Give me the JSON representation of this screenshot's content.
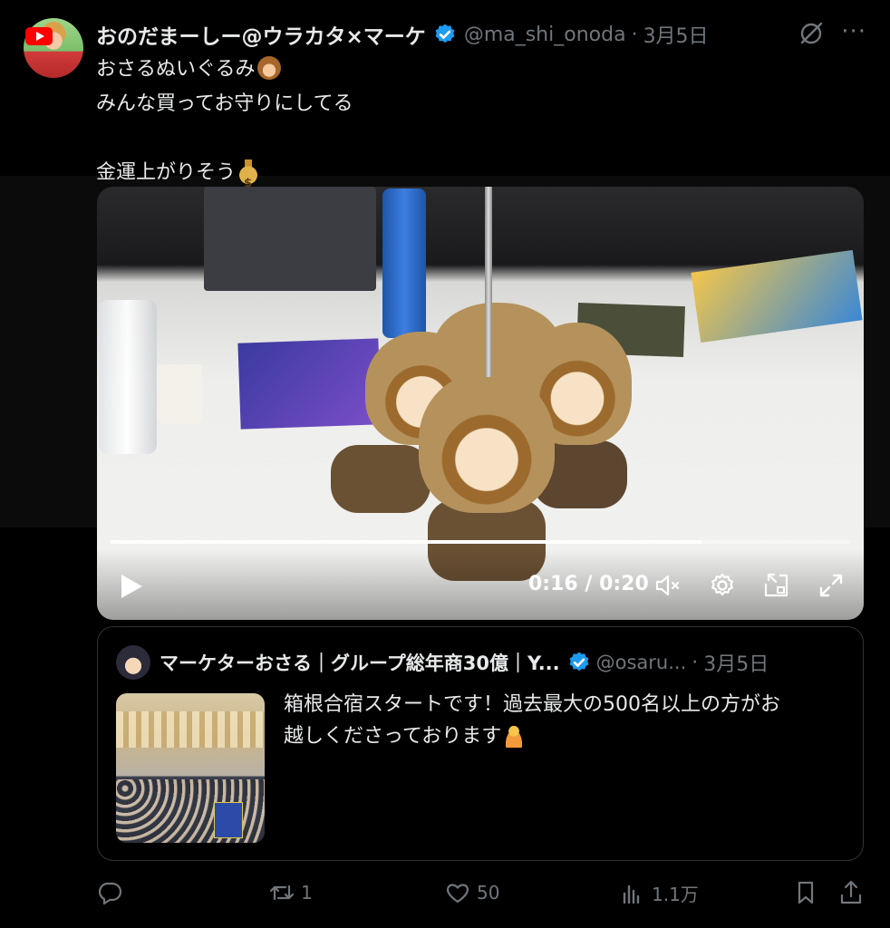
{
  "tweet": {
    "author_name": "おのだまーしー@ウラカタ×マーケ",
    "author_handle": "@ma_shi_onoda",
    "separator": "·",
    "date": "3月5日",
    "more_label": "···",
    "lines": [
      "おさるぬいぐるみ",
      "みんな買ってお守りにしてる",
      "",
      "金運上がりそう"
    ]
  },
  "video": {
    "timecode": "0:16 / 0:20",
    "progress": 0.8
  },
  "quote": {
    "author_name": "マーケターおさる｜グループ総年商30億｜Y...",
    "author_handle": "@osaru...",
    "separator": "·",
    "date": "3月5日",
    "text_line1": "箱根合宿スタートです！過去最大の500名以上の方がお",
    "text_line2": "越しくださっております"
  },
  "actions": {
    "reply_count": "",
    "retweet_count": "1",
    "like_count": "50",
    "views_count": "1.1万"
  },
  "colors": {
    "background": "#000000",
    "text": "#e7e9ea",
    "muted": "#71767b",
    "verified": "#1d9bf0",
    "border": "#2f3336"
  },
  "icons": [
    "youtube-badge-icon",
    "verified-badge-icon",
    "grok-icon",
    "more-icon",
    "monkey-emoji-icon",
    "money-bag-emoji-icon",
    "play-icon",
    "mute-icon",
    "settings-icon",
    "picture-in-picture-icon",
    "fullscreen-icon",
    "reply-icon",
    "retweet-icon",
    "like-icon",
    "views-icon",
    "bookmark-icon",
    "share-icon",
    "person-bowing-emoji-icon"
  ]
}
